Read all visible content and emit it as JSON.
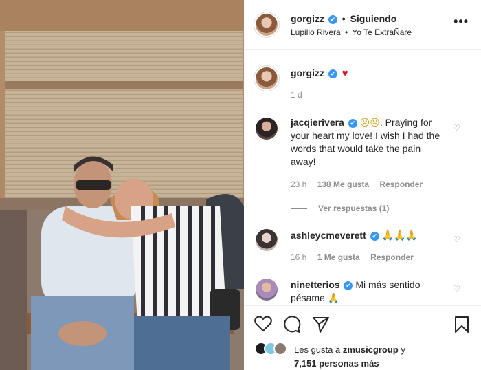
{
  "header": {
    "username": "gorgizz",
    "dot": "•",
    "follow_label": "Siguiendo",
    "artist": "Lupillo Rivera",
    "separator": "•",
    "song": "Yo Te ExtraÑare",
    "more_label": "•••"
  },
  "caption": {
    "username": "gorgizz",
    "emoji": "♥",
    "time": "1 d"
  },
  "comments": [
    {
      "username": "jacqierivera",
      "emojis": "☹☹",
      "text": ". Praying for your heart my love! I wish I had the words that would take the pain away!",
      "time": "23 h",
      "likes": "138 Me gusta",
      "reply": "Responder",
      "view_replies": "Ver respuestas (1)"
    },
    {
      "username": "ashleycmeverett",
      "emojis": "🙏🙏🙏",
      "text": "",
      "time": "16 h",
      "likes": "1 Me gusta",
      "reply": "Responder"
    },
    {
      "username": "ninetterios",
      "text": "Mi más sentido pésame",
      "emojis": "🙏"
    }
  ],
  "footer": {
    "liked_prefix": "Les gusta a",
    "liked_user": "zmusicgroup",
    "liked_suffix": "y",
    "others": "7,151 personas más"
  },
  "colors": {
    "verified": "#3897f0",
    "heart": "#d11b2b",
    "muted": "#8e8e8e"
  },
  "icons": [
    "verified-badge-icon",
    "heart-icon",
    "comment-icon",
    "share-icon",
    "bookmark-icon",
    "more-icon",
    "like-heart-icon"
  ]
}
